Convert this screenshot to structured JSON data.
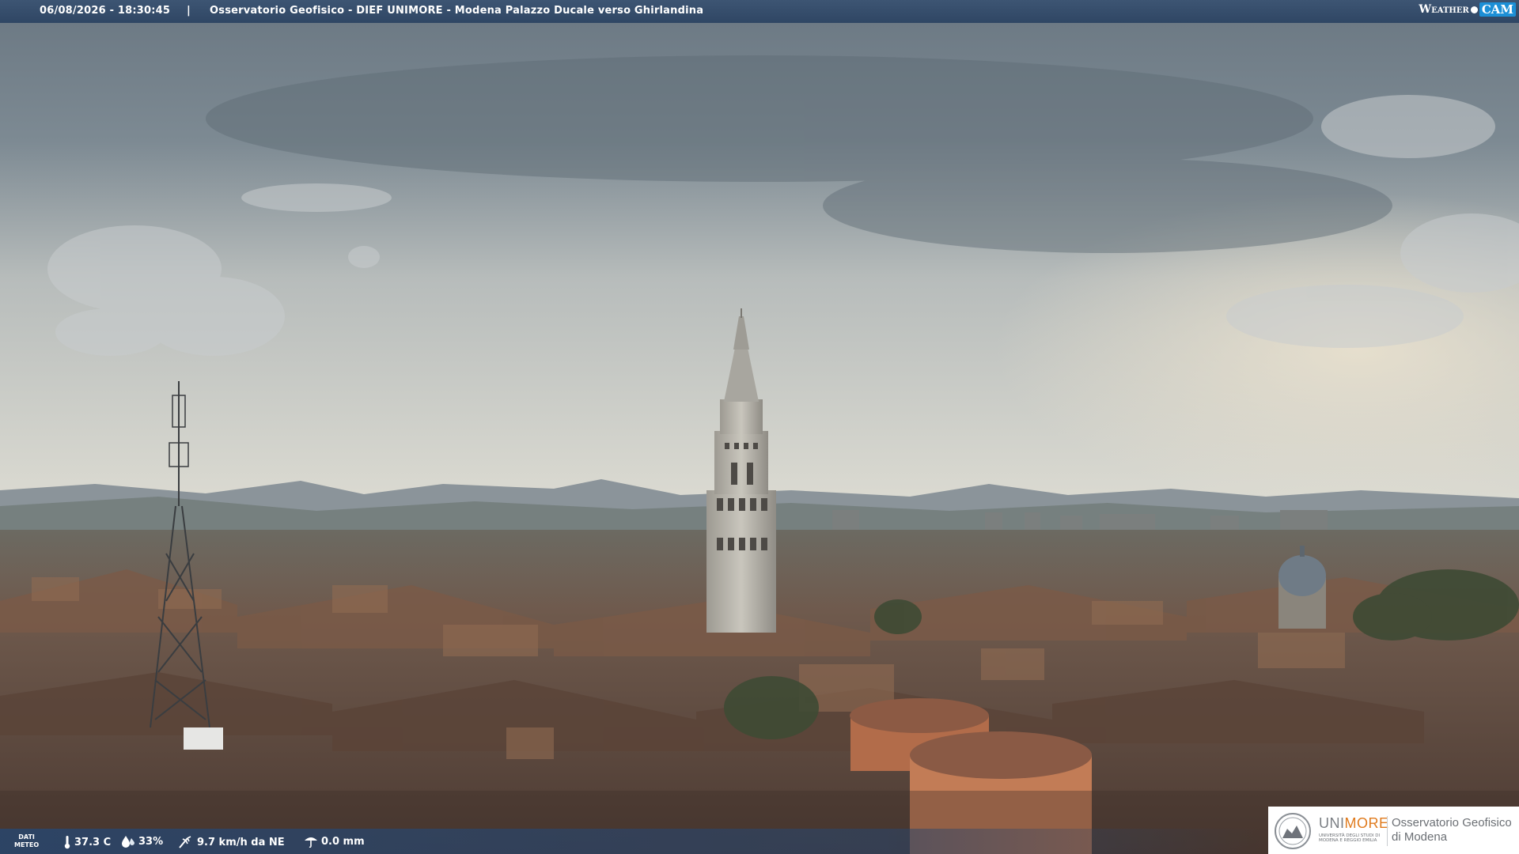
{
  "header": {
    "timestamp": "06/08/2026 - 18:30:45",
    "separator": "|",
    "title": "Osservatorio Geofisico - DIEF UNIMORE - Modena Palazzo Ducale verso Ghirlandina"
  },
  "brand": {
    "left": "Weather",
    "right": "CAM"
  },
  "weather": {
    "label_line1": "DATI",
    "label_line2": "METEO",
    "temperature": "37.3 C",
    "humidity": "33%",
    "wind": "9.7 km/h da NE",
    "rain": "0.0 mm",
    "icons": [
      "thermometer-icon",
      "humidity-drop-icon",
      "wind-icon",
      "rain-gauge-icon"
    ]
  },
  "logo": {
    "uni_a": "UNI",
    "uni_b": "MORE",
    "uni_sub": "UNIVERSITÀ DEGLI STUDI DI MODENA E REGGIO EMILIA",
    "obs_line1": "Osservatorio Geofisico",
    "obs_line2": "di Modena"
  },
  "colors": {
    "header_bg": "#2f4664",
    "brand_accent": "#1c8fd6",
    "unimore_orange": "#e07b1e"
  }
}
